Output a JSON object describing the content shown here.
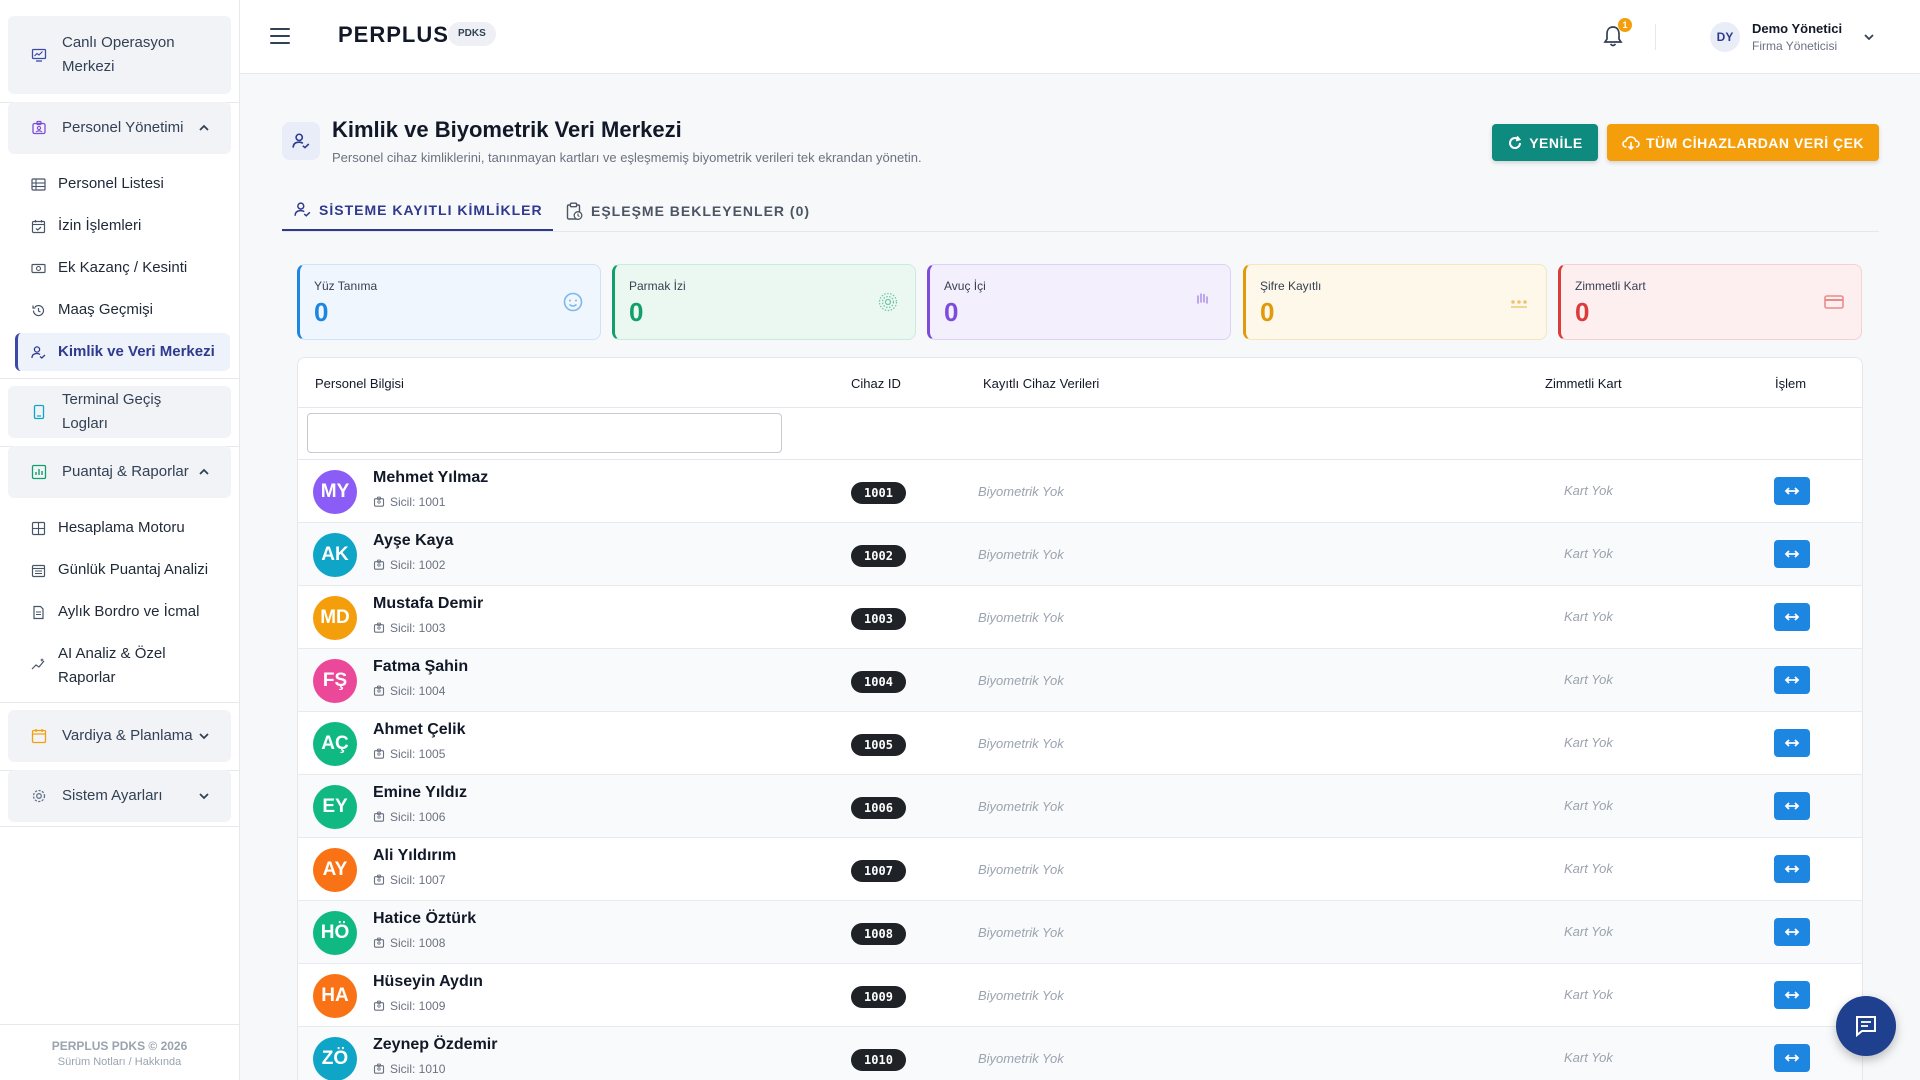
{
  "sidebar": {
    "groups": {
      "live": "Canlı Operasyon Merkezi",
      "personel": "Personel Yönetimi",
      "terminal": "Terminal Geçiş Logları",
      "puantaj": "Puantaj & Raporlar",
      "vardiya": "Vardiya & Planlama",
      "sistem": "Sistem Ayarları"
    },
    "personel_items": [
      "Personel Listesi",
      "İzin İşlemleri",
      "Ek Kazanç / Kesinti",
      "Maaş Geçmişi",
      "Kimlik ve Veri Merkezi"
    ],
    "puantaj_items": [
      "Hesaplama Motoru",
      "Günlük Puantaj Analizi",
      "Aylık Bordro ve İcmal",
      "AI Analiz & Özel Raporlar"
    ],
    "footer_title": "PERPLUS PDKS © 2026",
    "footer_sub": "Sürüm Notları / Hakkında"
  },
  "topbar": {
    "logo": "PERPLUS",
    "logo_badge": "PDKS",
    "notification_count": "1",
    "user_initials": "DY",
    "user_name": "Demo Yönetici",
    "user_role": "Firma Yöneticisi"
  },
  "header": {
    "title": "Kimlik ve Biyometrik Veri Merkezi",
    "subtitle": "Personel cihaz kimliklerini, tanınmayan kartları ve eşleşmemiş biyometrik verileri tek ekrandan yönetin.",
    "refresh_label": "YENİLE",
    "pull_label": "TÜM CİHAZLARDAN VERİ ÇEK"
  },
  "tabs": [
    "SİSTEME KAYITLI KİMLİKLER",
    "EŞLEŞME BEKLEYENLER (0)"
  ],
  "stats": [
    {
      "label": "Yüz Tanıma",
      "value": "0",
      "color": "#1d86e0",
      "bg": "#eff6fd",
      "border": "#cfe2f7",
      "icon": "face-icon"
    },
    {
      "label": "Parmak İzi",
      "value": "0",
      "color": "#12a06a",
      "bg": "#ebf8f2",
      "border": "#c8ecdc",
      "icon": "fingerprint-icon"
    },
    {
      "label": "Avuç İçi",
      "value": "0",
      "color": "#7c4ddb",
      "bg": "#f3effc",
      "border": "#ddd2f5",
      "icon": "palm-icon"
    },
    {
      "label": "Şifre Kayıtlı",
      "value": "0",
      "color": "#e09a0a",
      "bg": "#fdf8ea",
      "border": "#f4e6bf",
      "icon": "password-icon"
    },
    {
      "label": "Zimmetli Kart",
      "value": "0",
      "color": "#dc3b3b",
      "bg": "#fdefef",
      "border": "#f5d1d1",
      "icon": "card-icon"
    }
  ],
  "table": {
    "headers": [
      "Personel Bilgisi",
      "Cihaz ID",
      "Kayıtlı Cihaz Verileri",
      "Zimmetli Kart",
      "İşlem"
    ],
    "filter_value": "",
    "rows": [
      {
        "initials": "MY",
        "color": "#8b5cf6",
        "name": "Mehmet Yılmaz",
        "sicil": "Sicil: 1001",
        "device_id": "1001",
        "bio": "Biyometrik Yok",
        "card": "Kart Yok"
      },
      {
        "initials": "AK",
        "color": "#0ea5c6",
        "name": "Ayşe Kaya",
        "sicil": "Sicil: 1002",
        "device_id": "1002",
        "bio": "Biyometrik Yok",
        "card": "Kart Yok"
      },
      {
        "initials": "MD",
        "color": "#f59e0b",
        "name": "Mustafa Demir",
        "sicil": "Sicil: 1003",
        "device_id": "1003",
        "bio": "Biyometrik Yok",
        "card": "Kart Yok"
      },
      {
        "initials": "FŞ",
        "color": "#ec4899",
        "name": "Fatma Şahin",
        "sicil": "Sicil: 1004",
        "device_id": "1004",
        "bio": "Biyometrik Yok",
        "card": "Kart Yok"
      },
      {
        "initials": "AÇ",
        "color": "#10b981",
        "name": "Ahmet Çelik",
        "sicil": "Sicil: 1005",
        "device_id": "1005",
        "bio": "Biyometrik Yok",
        "card": "Kart Yok"
      },
      {
        "initials": "EY",
        "color": "#10b981",
        "name": "Emine Yıldız",
        "sicil": "Sicil: 1006",
        "device_id": "1006",
        "bio": "Biyometrik Yok",
        "card": "Kart Yok"
      },
      {
        "initials": "AY",
        "color": "#f97316",
        "name": "Ali Yıldırım",
        "sicil": "Sicil: 1007",
        "device_id": "1007",
        "bio": "Biyometrik Yok",
        "card": "Kart Yok"
      },
      {
        "initials": "HÖ",
        "color": "#10b981",
        "name": "Hatice Öztürk",
        "sicil": "Sicil: 1008",
        "device_id": "1008",
        "bio": "Biyometrik Yok",
        "card": "Kart Yok"
      },
      {
        "initials": "HA",
        "color": "#f97316",
        "name": "Hüseyin Aydın",
        "sicil": "Sicil: 1009",
        "device_id": "1009",
        "bio": "Biyometrik Yok",
        "card": "Kart Yok"
      },
      {
        "initials": "ZÖ",
        "color": "#0ea5c6",
        "name": "Zeynep Özdemir",
        "sicil": "Sicil: 1010",
        "device_id": "1010",
        "bio": "Biyometrik Yok",
        "card": "Kart Yok"
      }
    ]
  }
}
